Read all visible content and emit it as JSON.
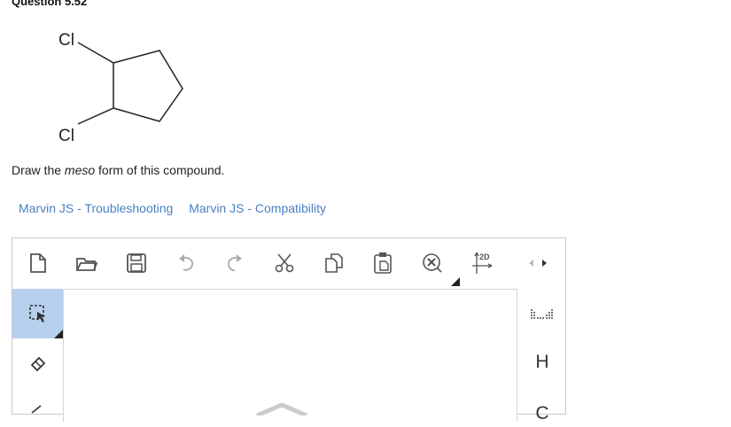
{
  "question": {
    "title": "Question 5.52"
  },
  "molecule": {
    "atom_top": "Cl",
    "atom_bottom": "Cl"
  },
  "prompt": {
    "before": "Draw the ",
    "emphasis": "meso",
    "after": " form of this compound."
  },
  "links": [
    {
      "label": "Marvin JS - Troubleshooting"
    },
    {
      "label": "Marvin JS - Compatibility"
    }
  ],
  "editor": {
    "toolbar": [
      "new-document-icon",
      "open-folder-icon",
      "save-icon",
      "undo-icon",
      "redo-icon",
      "cut-icon",
      "copy-icon",
      "paste-icon",
      "clear-icon",
      "clean-2d-icon"
    ],
    "toolbar_2d_label": "2D",
    "left_tools": [
      "selection-icon",
      "eraser-icon"
    ],
    "right_tools": {
      "periodic_table": "periodic-table-icon",
      "element_h": "H",
      "element_c": "C"
    }
  },
  "colors": {
    "link": "#4a7fc2",
    "active_tool": "#b7d0ee",
    "border": "#c9c9c9"
  }
}
